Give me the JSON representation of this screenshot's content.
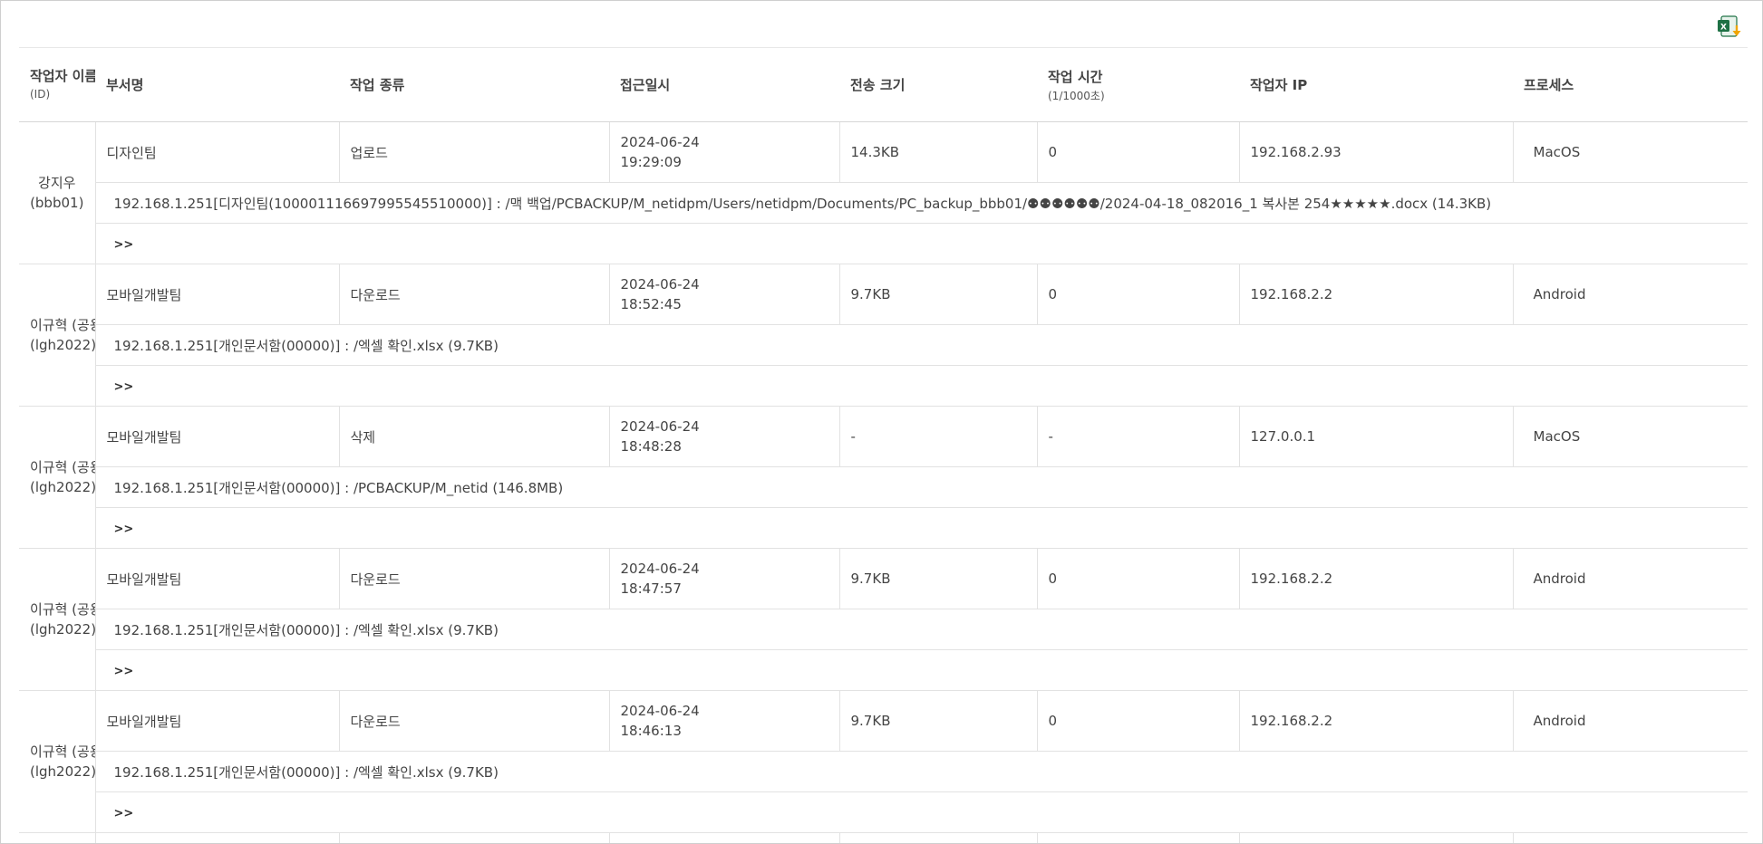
{
  "toolbar": {
    "excel_icon": "excel-download-icon"
  },
  "columns": {
    "name": "작업자 이름",
    "name_sub": "(ID)",
    "dept": "부서명",
    "type": "작업 종류",
    "access": "접근일시",
    "size": "전송 크기",
    "time": "작업 시간",
    "time_sub": "(1/1000초)",
    "ip": "작업자 IP",
    "process": "프로세스"
  },
  "rows": [
    {
      "user": "강지우",
      "uid": "(bbb01)",
      "dept": "디자인팀",
      "type": "업로드",
      "date": "2024-06-24",
      "time": "19:29:09",
      "size": "14.3KB",
      "duration": "0",
      "ip": "192.168.2.93",
      "process": "MacOS",
      "detail": "192.168.1.251[디자인팀(10000111669799554551000​0)] : /맥 백업/PCBACKUP/M_netidpm/Users/netidpm/Documents/PC_backup_bbb01/⚉⚉⚉⚉⚉⚉/2024-04-18_082016_1 복사본 254★★★★★.docx (14.3KB)",
      "more": ">>"
    },
    {
      "user": "이규혁 (공용)",
      "uid": "(lgh2022)",
      "dept": "모바일개발팀",
      "type": "다운로드",
      "date": "2024-06-24",
      "time": "18:52:45",
      "size": "9.7KB",
      "duration": "0",
      "ip": "192.168.2.2",
      "process": "Android",
      "detail": "192.168.1.251[개인문서함(00000)] : /엑셀 확인.xlsx (9.7KB)",
      "more": ">>"
    },
    {
      "user": "이규혁 (공용)",
      "uid": "(lgh2022)",
      "dept": "모바일개발팀",
      "type": "삭제",
      "date": "2024-06-24",
      "time": "18:48:28",
      "size": "-",
      "duration": "-",
      "ip": "127.0.0.1",
      "process": "MacOS",
      "detail": "192.168.1.251[개인문서함(00000)] : /PCBACKUP/M_netid (146.8MB)",
      "more": ">>"
    },
    {
      "user": "이규혁 (공용)",
      "uid": "(lgh2022)",
      "dept": "모바일개발팀",
      "type": "다운로드",
      "date": "2024-06-24",
      "time": "18:47:57",
      "size": "9.7KB",
      "duration": "0",
      "ip": "192.168.2.2",
      "process": "Android",
      "detail": "192.168.1.251[개인문서함(00000)] : /엑셀 확인.xlsx (9.7KB)",
      "more": ">>"
    },
    {
      "user": "이규혁 (공용)",
      "uid": "(lgh2022)",
      "dept": "모바일개발팀",
      "type": "다운로드",
      "date": "2024-06-24",
      "time": "18:46:13",
      "size": "9.7KB",
      "duration": "0",
      "ip": "192.168.2.2",
      "process": "Android",
      "detail": "192.168.1.251[개인문서함(00000)] : /엑셀 확인.xlsx (9.7KB)",
      "more": ">>"
    }
  ]
}
